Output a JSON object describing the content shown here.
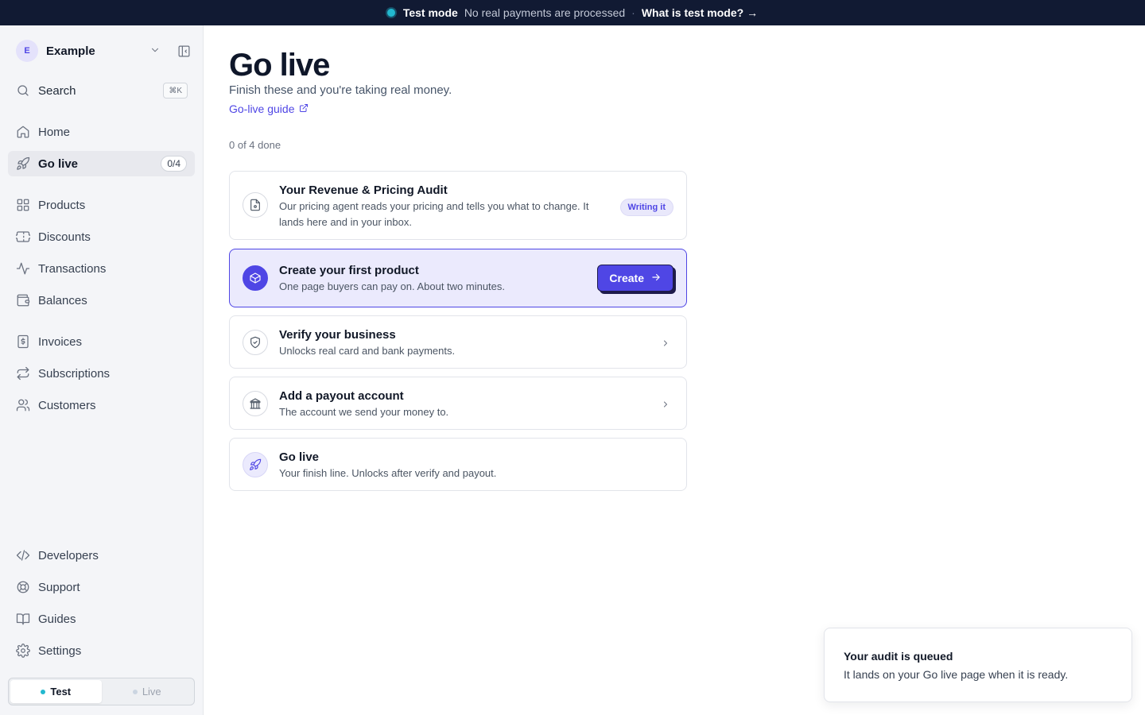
{
  "banner": {
    "mode": "Test mode",
    "note": "No real payments are processed",
    "separator": "·",
    "link": "What is test mode?",
    "link_arrow": "→"
  },
  "workspace": {
    "initial": "E",
    "name": "Example"
  },
  "search": {
    "label": "Search",
    "shortcut": "⌘K"
  },
  "nav": {
    "home": "Home",
    "go_live": "Go live",
    "go_live_count": "0/4",
    "products": "Products",
    "discounts": "Discounts",
    "transactions": "Transactions",
    "balances": "Balances",
    "invoices": "Invoices",
    "subscriptions": "Subscriptions",
    "customers": "Customers",
    "developers": "Developers",
    "support": "Support",
    "guides": "Guides",
    "settings": "Settings"
  },
  "env_toggle": {
    "test": "Test",
    "live": "Live",
    "selected": "Test"
  },
  "page": {
    "title": "Go live",
    "subtitle": "Finish these and you're taking real money.",
    "guide_link": "Go-live guide",
    "progress": "0 of 4 done"
  },
  "tasks": [
    {
      "title": "Your Revenue & Pricing Audit",
      "desc": "Our pricing agent reads your pricing and tells you what to change. It lands here and in your inbox.",
      "badge": "Writing it"
    },
    {
      "title": "Create your first product",
      "desc": "One page buyers can pay on. About two minutes.",
      "action": "Create"
    },
    {
      "title": "Verify your business",
      "desc": "Unlocks real card and bank payments."
    },
    {
      "title": "Add a payout account",
      "desc": "The account we send your money to."
    },
    {
      "title": "Go live",
      "desc": "Your finish line. Unlocks after verify and payout."
    }
  ],
  "toast": {
    "title": "Your audit is queued",
    "message": "It lands on your Go live page when it is ready."
  },
  "colors": {
    "accent": "#4f46e5",
    "banner_bg": "#111a33",
    "test_dot": "#22b8cf",
    "sidebar_bg": "#f4f5f8"
  }
}
